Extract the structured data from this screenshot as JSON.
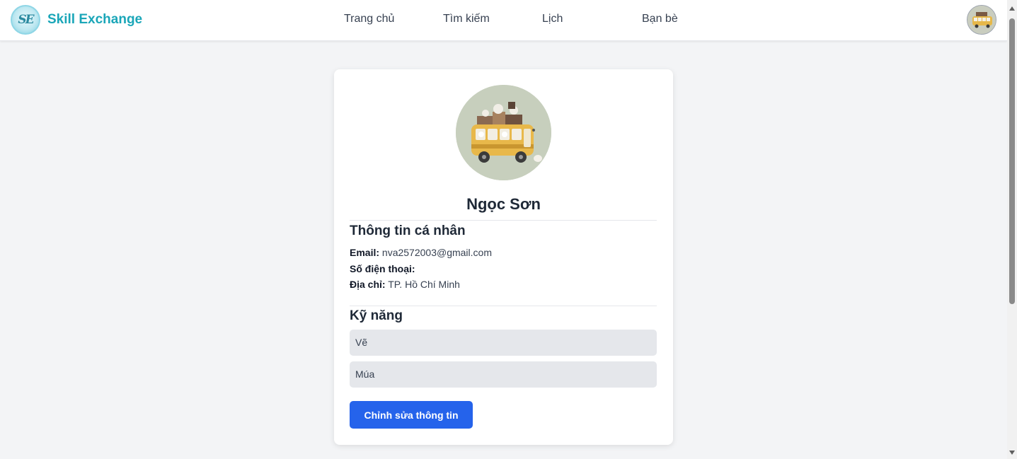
{
  "header": {
    "brand_name": "Skill Exchange",
    "logo_text": "SE",
    "nav": [
      {
        "label": "Trang chủ"
      },
      {
        "label": "Tìm kiếm"
      },
      {
        "label": "Lịch"
      },
      {
        "label": "Bạn bè"
      }
    ],
    "brand_color": "#1aa6b8"
  },
  "profile": {
    "name": "Ngọc Sơn",
    "personal_info_title": "Thông tin cá nhân",
    "email_label": "Email:",
    "email_value": "nva2572003@gmail.com",
    "phone_label": "Số điện thoại:",
    "phone_value": "",
    "address_label": "Địa chỉ:",
    "address_value": "TP. Hồ Chí Minh",
    "skills_title": "Kỹ năng",
    "skills": [
      {
        "label": "Vẽ"
      },
      {
        "label": "Múa"
      }
    ],
    "edit_button_label": "Chỉnh sửa thông tin",
    "accent_color": "#2563eb"
  }
}
